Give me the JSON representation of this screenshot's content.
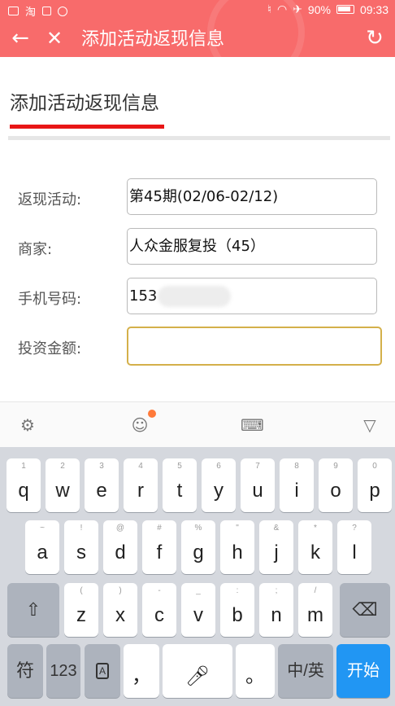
{
  "status_bar": {
    "battery": "90%",
    "time": "09:33"
  },
  "title_bar": {
    "title": "添加活动返现信息"
  },
  "page": {
    "heading": "添加活动返现信息"
  },
  "form": {
    "rows": [
      {
        "label": "返现活动:",
        "value": "第45期(02/06-02/12)"
      },
      {
        "label": "商家:",
        "value": "人众金服复投（45）"
      },
      {
        "label": "手机号码:",
        "value": "153"
      },
      {
        "label": "投资金额:",
        "value": ""
      }
    ]
  },
  "keyboard": {
    "row1": [
      {
        "hint": "1",
        "key": "q"
      },
      {
        "hint": "2",
        "key": "w"
      },
      {
        "hint": "3",
        "key": "e"
      },
      {
        "hint": "4",
        "key": "r"
      },
      {
        "hint": "5",
        "key": "t"
      },
      {
        "hint": "6",
        "key": "y"
      },
      {
        "hint": "7",
        "key": "u"
      },
      {
        "hint": "8",
        "key": "i"
      },
      {
        "hint": "9",
        "key": "o"
      },
      {
        "hint": "0",
        "key": "p"
      }
    ],
    "row2": [
      {
        "hint": "~",
        "key": "a"
      },
      {
        "hint": "!",
        "key": "s"
      },
      {
        "hint": "@",
        "key": "d"
      },
      {
        "hint": "#",
        "key": "f"
      },
      {
        "hint": "%",
        "key": "g"
      },
      {
        "hint": "\"",
        "key": "h"
      },
      {
        "hint": "&",
        "key": "j"
      },
      {
        "hint": "*",
        "key": "k"
      },
      {
        "hint": "?",
        "key": "l"
      }
    ],
    "row3": [
      {
        "hint": "(",
        "key": "z"
      },
      {
        "hint": ")",
        "key": "x"
      },
      {
        "hint": "-",
        "key": "c"
      },
      {
        "hint": "_",
        "key": "v"
      },
      {
        "hint": ":",
        "key": "b"
      },
      {
        "hint": ";",
        "key": "n"
      },
      {
        "hint": "/",
        "key": "m"
      }
    ],
    "row4": {
      "symbols": "符",
      "numbers": "123",
      "comma": "，",
      "period": "。",
      "lang": "中/英",
      "go": "开始"
    }
  }
}
